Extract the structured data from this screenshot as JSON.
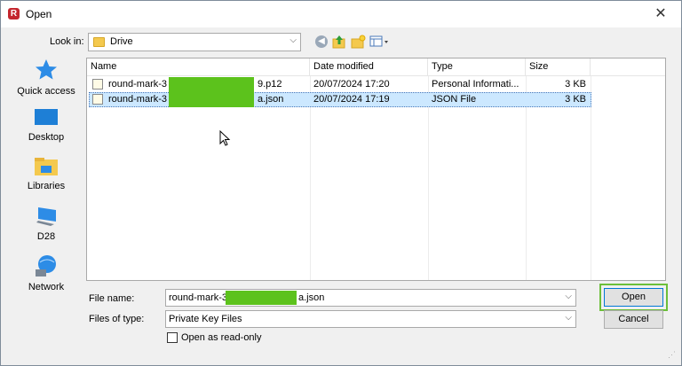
{
  "window": {
    "title": "Open",
    "app_icon_letter": "R"
  },
  "lookin": {
    "label": "Look in:",
    "value": "Drive"
  },
  "places": [
    {
      "label": "Quick access",
      "icon": "quick-access-star-icon"
    },
    {
      "label": "Desktop",
      "icon": "desktop-icon"
    },
    {
      "label": "Libraries",
      "icon": "libraries-icon"
    },
    {
      "label": "D28",
      "icon": "computer-icon"
    },
    {
      "label": "Network",
      "icon": "network-icon"
    }
  ],
  "columns": [
    "Name",
    "Date modified",
    "Type",
    "Size"
  ],
  "files": [
    {
      "name_start": "round-mark-3",
      "name_end": "9.p12",
      "date": "20/07/2024 17:20",
      "type": "Personal Informati...",
      "size": "3 KB",
      "selected": false
    },
    {
      "name_start": "round-mark-3",
      "name_end": "a.json",
      "date": "20/07/2024 17:19",
      "type": "JSON File",
      "size": "3 KB",
      "selected": true
    }
  ],
  "filename": {
    "label": "File name:",
    "value_start": "round-mark-3",
    "value_end": "a.json"
  },
  "filetype": {
    "label": "Files of type:",
    "value": "Private Key Files"
  },
  "readonly": {
    "label": "Open as read-only",
    "checked": false
  },
  "buttons": {
    "open": "Open",
    "cancel": "Cancel"
  },
  "colors": {
    "selection": "#cce8ff",
    "redaction": "#5cc21c",
    "highlight_outline": "#6cbf3a"
  }
}
